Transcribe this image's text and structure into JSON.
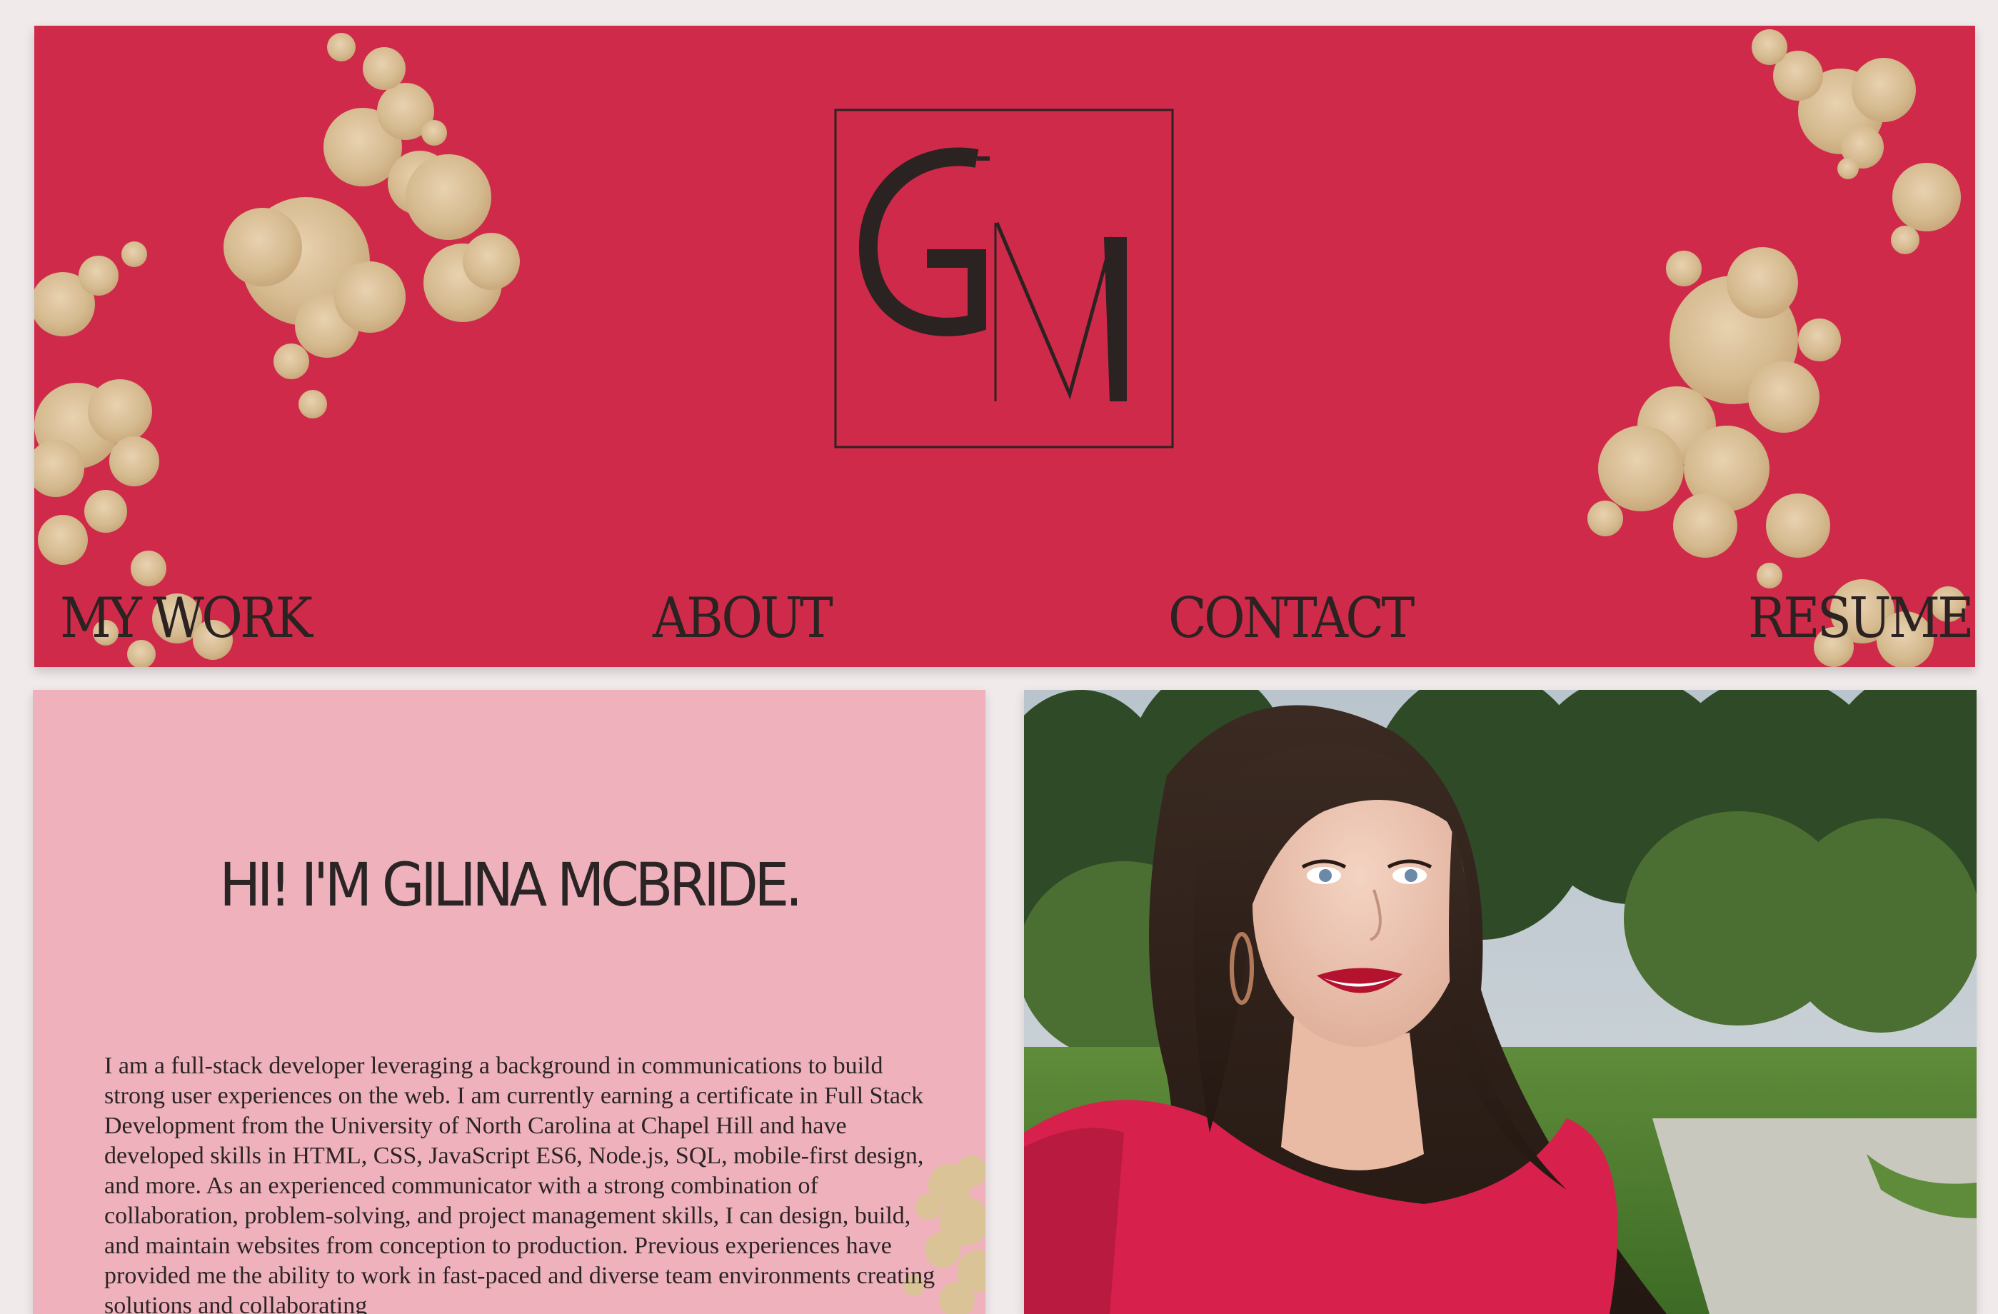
{
  "header": {
    "logo_letters": "GM",
    "colors": {
      "background": "#d02a4a",
      "gold": "#d8c49a",
      "ink": "#2b2222"
    },
    "nav": [
      {
        "label": "MY WORK"
      },
      {
        "label": "ABOUT"
      },
      {
        "label": "CONTACT"
      },
      {
        "label": "RESUME"
      }
    ]
  },
  "about": {
    "title": "HI! I'M GILINA MCBRIDE.",
    "bio": "I am a full-stack developer leveraging a background in communications to build strong user experiences on the web. I am currently earning a certificate in Full Stack Development from the University of North Carolina at Chapel Hill and have developed skills in HTML, CSS, JavaScript ES6, Node.js, SQL, mobile-first design, and more. As an experienced communicator with a strong combination of collaboration, problem-solving, and project management skills, I can design, build, and maintain websites from conception to production. Previous experiences have provided me the ability to work in fast-paced and diverse team environments creating solutions and collaborating",
    "background_color": "#efb1bc"
  },
  "photo": {
    "subject": "portrait-photo"
  }
}
